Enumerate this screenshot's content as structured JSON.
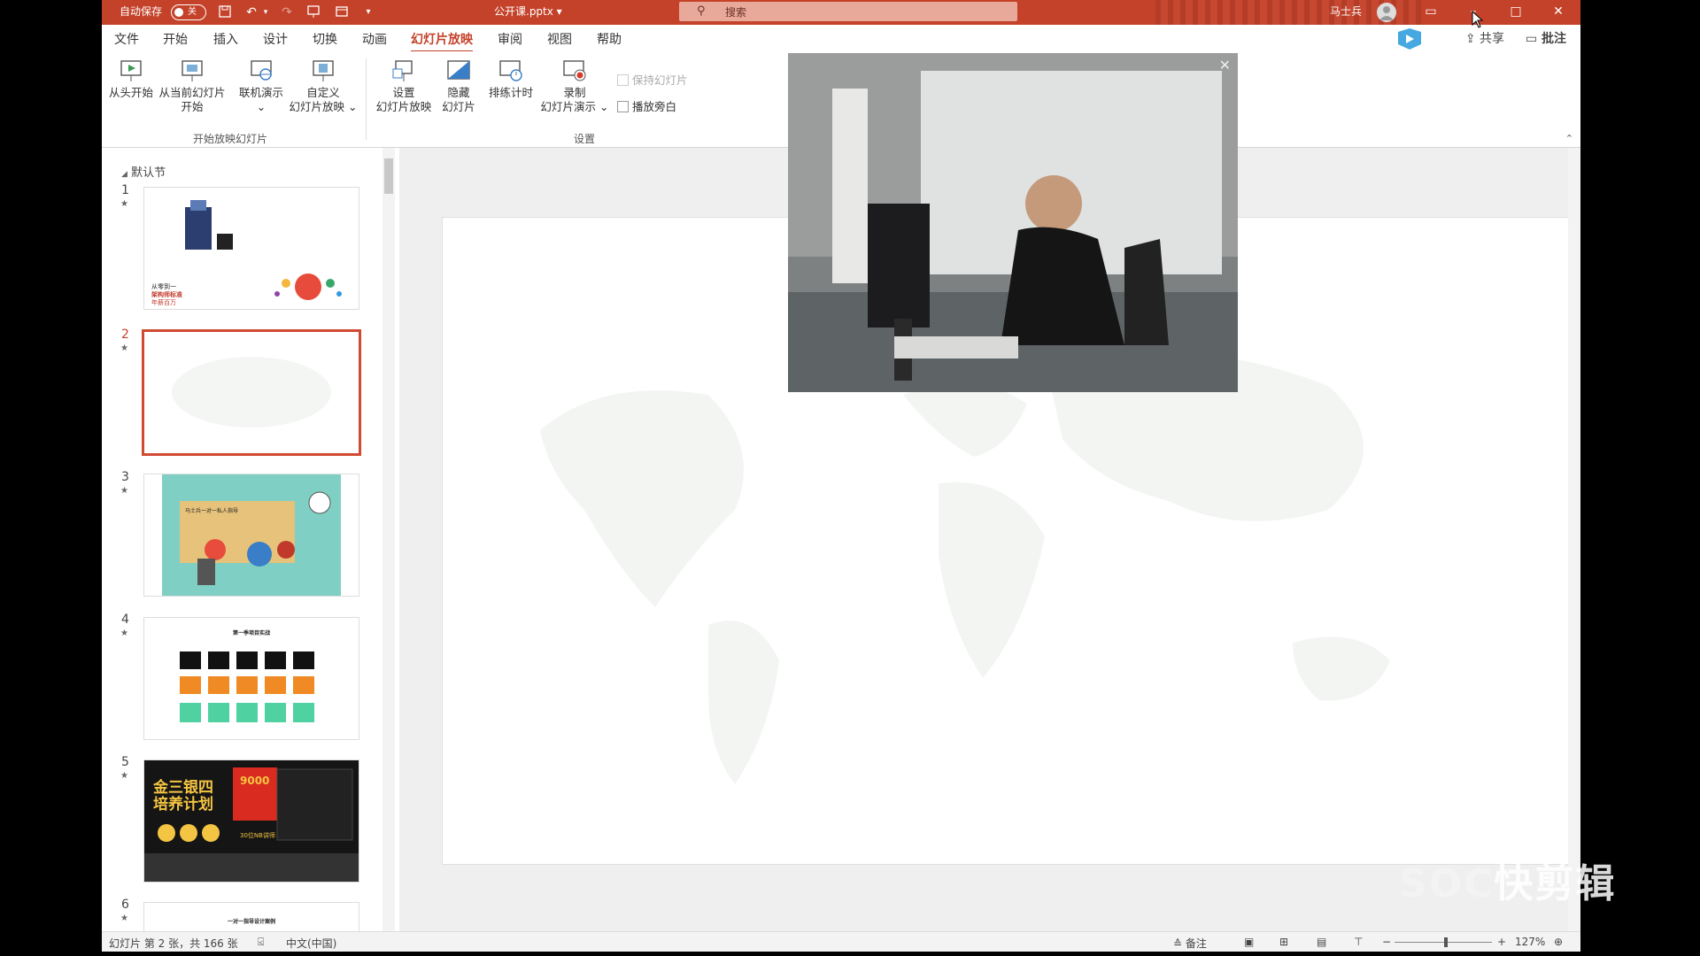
{
  "titlebar": {
    "autosave_label": "自动保存",
    "autosave_state": "关",
    "filename": "公开课.pptx",
    "search_placeholder": "搜索",
    "username": "马士兵",
    "bg_color": "#c4422a"
  },
  "menu": {
    "tabs": [
      "文件",
      "开始",
      "插入",
      "设计",
      "切换",
      "动画",
      "幻灯片放映",
      "审阅",
      "视图",
      "帮助"
    ],
    "active": "幻灯片放映",
    "share_label": "共享",
    "comment_label": "批注"
  },
  "ribbon": {
    "group1": {
      "buttons": [
        {
          "l1": "从头开始",
          "l2": ""
        },
        {
          "l1": "从当前幻灯片",
          "l2": "开始"
        },
        {
          "l1": "联机演示",
          "l2": "⌄"
        },
        {
          "l1": "自定义",
          "l2": "幻灯片放映 ⌄"
        }
      ],
      "label": "开始放映幻灯片"
    },
    "group2": {
      "buttons": [
        {
          "l1": "设置",
          "l2": "幻灯片放映"
        },
        {
          "l1": "隐藏",
          "l2": "幻灯片"
        },
        {
          "l1": "排练计时",
          "l2": ""
        },
        {
          "l1": "录制",
          "l2": "幻灯片演示 ⌄"
        }
      ],
      "checkbox_keep": "保持幻灯片",
      "checkbox_narration": "播放旁白",
      "label": "设置"
    }
  },
  "thumbnails": {
    "section": "默认节",
    "slides": [
      {
        "num": "1",
        "texts": [
          "从零到一",
          "架构师标准",
          "年薪百万"
        ]
      },
      {
        "num": "2",
        "texts": []
      },
      {
        "num": "3",
        "texts": [
          "马士兵一对一私人指导"
        ]
      },
      {
        "num": "4",
        "texts": [
          "第一季项目实战"
        ]
      },
      {
        "num": "5",
        "texts": [
          "金三银四",
          "培养计划",
          "9000",
          "30位NB讲师"
        ]
      },
      {
        "num": "6",
        "texts": [
          "一对一指导设计案例"
        ]
      }
    ],
    "selected": 2
  },
  "status": {
    "slide_info": "幻灯片 第 2 张，共 166 张",
    "language": "中文(中国)",
    "notes": "备注",
    "zoom": "127%"
  },
  "watermark": {
    "text_dim": "SOC",
    "text": "快剪辑"
  }
}
